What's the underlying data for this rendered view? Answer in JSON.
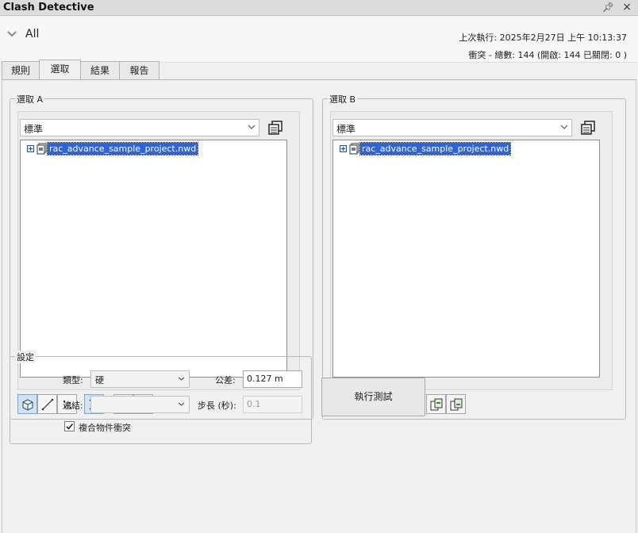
{
  "window": {
    "title": "Clash Detective",
    "pin_icon": "pin-icon",
    "close_icon": "close-icon"
  },
  "header": {
    "test_name": "All",
    "last_run": "上次執行:  2025年2月27日 上午 10:13:37",
    "clash_summary": "衝突 -  總數:  144  (開啟:  144  已關閉:  0 )"
  },
  "tabs": [
    {
      "label": "規則",
      "active": false
    },
    {
      "label": "選取",
      "active": true
    },
    {
      "label": "結果",
      "active": false
    },
    {
      "label": "報告",
      "active": false
    }
  ],
  "selection_a": {
    "legend": "選取 A",
    "dropdown_value": "標準",
    "tree_item": "rac_advance_sample_project.nwd"
  },
  "selection_b": {
    "legend": "選取 B",
    "dropdown_value": "標準",
    "tree_item": "rac_advance_sample_project.nwd"
  },
  "settings": {
    "legend": "設定",
    "type_label": "類型:",
    "type_value": "硬",
    "tolerance_label": "公差:",
    "tolerance_value": "0.127 m",
    "link_label": "連結:",
    "link_value": "",
    "step_label": "步長 (秒):",
    "step_value": "0.1",
    "composite_label": "複合物件衝突",
    "composite_checked": true
  },
  "run_button": "執行測試",
  "colors": {
    "selection": "#2f64d8",
    "active_toggle": "#cfe2f7"
  }
}
